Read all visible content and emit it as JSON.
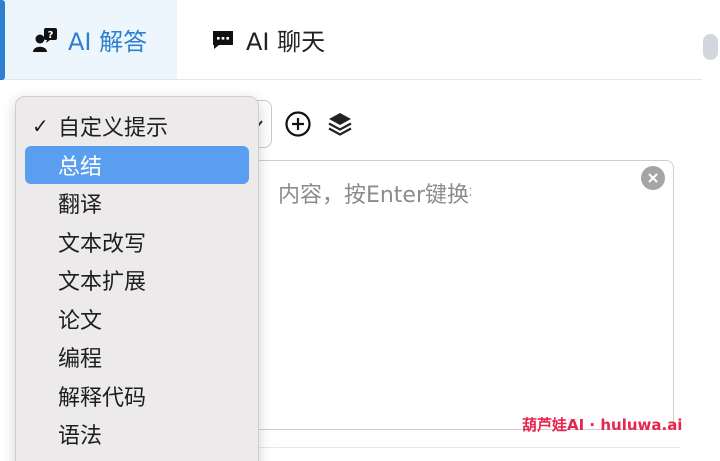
{
  "tabs": [
    {
      "label": "AI 解答",
      "icon": "user-question-icon",
      "active": true
    },
    {
      "label": "AI 聊天",
      "icon": "chat-bubble-icon",
      "active": false
    }
  ],
  "toolbar": {
    "add_icon": "plus-circle-icon",
    "layers_icon": "layers-icon"
  },
  "input": {
    "placeholder_visible": "内容，按Enter键换行",
    "clear_icon": "close-circle-icon"
  },
  "dropdown": {
    "selected": "自定义提示",
    "highlighted": "总结",
    "items": [
      "自定义提示",
      "总结",
      "翻译",
      "文本改写",
      "文本扩展",
      "论文",
      "编程",
      "解释代码",
      "语法"
    ]
  },
  "watermark": "葫芦娃AI · huluwa.ai",
  "colors": {
    "accent": "#2d7fd0",
    "highlight": "#5a9ef0",
    "watermark": "#e8254c"
  }
}
